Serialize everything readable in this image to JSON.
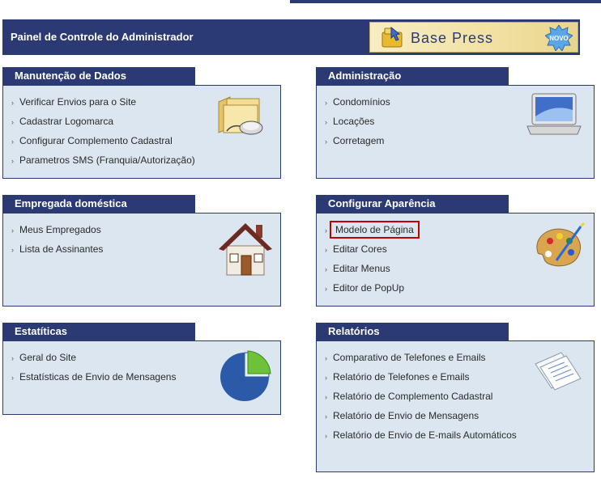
{
  "header": {
    "title": "Painel de Controle do Administrador",
    "logo_text": "Base Press",
    "badge": "NOVO"
  },
  "panels": [
    {
      "title": "Manutenção de Dados",
      "icon": "folder-mouse-icon",
      "items": [
        "Verificar Envios para o Site",
        "Cadastrar Logomarca",
        "Configurar Complemento Cadastral",
        "Parametros SMS (Franquia/Autorização)"
      ]
    },
    {
      "title": "Administração",
      "icon": "laptop-icon",
      "items": [
        "Condomínios",
        "Locações",
        "Corretagem"
      ]
    },
    {
      "title": "Empregada doméstica",
      "icon": "house-icon",
      "items": [
        "Meus Empregados",
        "Lista de Assinantes"
      ]
    },
    {
      "title": "Configurar Aparência",
      "icon": "palette-icon",
      "items": [
        "Modelo de Página",
        "Editar Cores",
        "Editar Menus",
        "Editor de PopUp"
      ],
      "selected": "Modelo de Página"
    },
    {
      "title": "Estatíticas",
      "icon": "pie-chart-icon",
      "items": [
        "Geral do Site",
        "Estatísticas de Envio de Mensagens"
      ]
    },
    {
      "title": "Relatórios",
      "icon": "documents-icon",
      "items": [
        "Comparativo de Telefones e Emails",
        "Relatório de Telefones e Emails",
        "Relatório de Complemento Cadastral",
        "Relatório de Envio de Mensagens",
        "Relatório de Envio de E-mails Automáticos"
      ]
    }
  ]
}
